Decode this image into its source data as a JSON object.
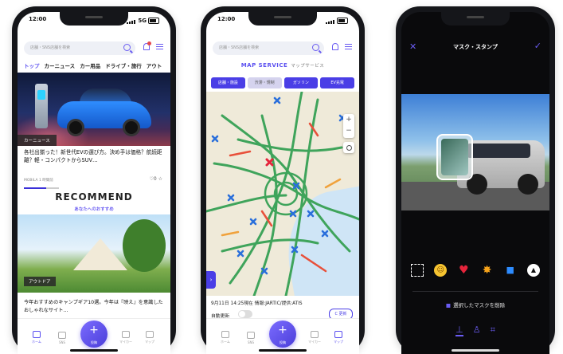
{
  "phones": [
    {
      "status": {
        "time": "12:00",
        "network": "5G"
      },
      "search": {
        "placeholder": "店舗・SNS店舗を検索"
      },
      "tabs": [
        "トップ",
        "カーニュース",
        "カー用品",
        "ドライブ・旅行",
        "アウト"
      ],
      "hero": {
        "tag": "カーニュース"
      },
      "article": {
        "title": "各社出揃った！新世代EVの選び方。決め手は価格？航続距離？軽・コンパクトからSUV…",
        "source": "MOBILA 1 時間前",
        "likes": "♡0 ☆"
      },
      "recommend": {
        "title": "RECOMMEND",
        "subtitle": "あなたへのおすすめ"
      },
      "article2": {
        "tag": "アウトドア",
        "title": "今年おすすめのキャンプギア10選。今年は『映え』を意識したおしゃれなサイト…"
      },
      "nav": [
        "ホーム",
        "SNS",
        "投稿",
        "マイカー",
        "マップ"
      ]
    },
    {
      "status": {
        "time": "12:00",
        "network": ""
      },
      "search": {
        "placeholder": "店舗・SNS店舗を検索"
      },
      "map_title": "MAP SERVICE",
      "map_subtitle": "マップサービス",
      "chips": [
        "店舗・施設",
        "渋滞・規制",
        "ガソリン",
        "EV充電"
      ],
      "info": "9月11日 14:25現在 情報:JARTIC/提供:ATIS",
      "auto_label": "自動更新",
      "refresh": "C 更新",
      "nav": [
        "ホーム",
        "SNS",
        "投稿",
        "マイカー",
        "マップ"
      ]
    },
    {
      "title": "マスク・スタンプ",
      "delete_label": "選択したマスクを削除"
    }
  ]
}
